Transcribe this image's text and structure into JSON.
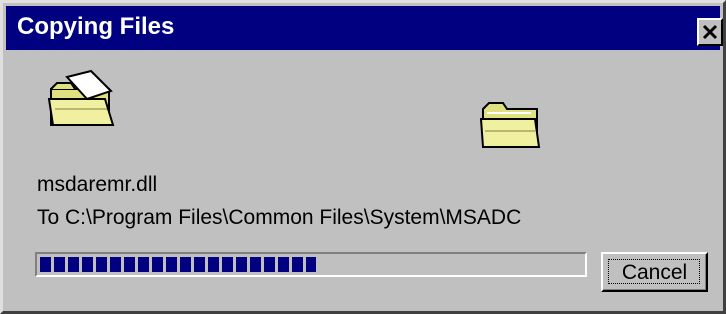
{
  "window": {
    "title": "Copying Files",
    "close_icon": "close-icon"
  },
  "copy": {
    "source_icon": "flying-folder-icon",
    "dest_icon": "open-folder-icon",
    "file_name": "msdaremr.dll",
    "destination": "To C:\\Program Files\\Common Files\\System\\MSADC"
  },
  "progress": {
    "fraction": 0.51,
    "color": "#000080"
  },
  "buttons": {
    "cancel_label": "Cancel"
  },
  "colors": {
    "title_bar": "#000080",
    "dialog_face": "#c0c0c0",
    "folder": "#e0e080"
  }
}
